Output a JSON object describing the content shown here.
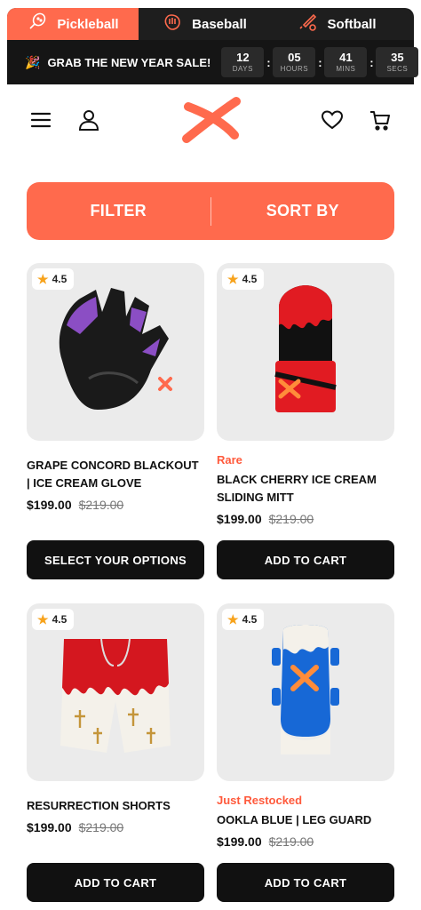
{
  "sport_tabs": [
    {
      "label": "Pickleball",
      "icon": "pickleball-paddle-icon",
      "active": true
    },
    {
      "label": "Baseball",
      "icon": "baseball-glove-icon",
      "active": false
    },
    {
      "label": "Softball",
      "icon": "softball-bat-icon",
      "active": false
    }
  ],
  "sale": {
    "text": "GRAB THE NEW YEAR SALE!",
    "icon": "party-popper-icon",
    "countdown": [
      {
        "value": "12",
        "label": "DAYS"
      },
      {
        "value": "05",
        "label": "HOURS"
      },
      {
        "value": "41",
        "label": "MINS"
      },
      {
        "value": "35",
        "label": "SECS"
      }
    ]
  },
  "header": {
    "icons": [
      "menu-icon",
      "user-icon",
      "heart-icon",
      "cart-icon"
    ],
    "logo": "brand-x-logo",
    "brand_color": "#ff6a4d"
  },
  "filter_bar": {
    "filter_label": "FILTER",
    "sort_label": "SORT BY"
  },
  "products": [
    {
      "rating": "4.5",
      "badge": "",
      "title": "GRAPE CONCORD BLACKOUT | ICE CREAM GLOVE",
      "price": "$199.00",
      "old_price": "$219.00",
      "cta": "SELECT YOUR OPTIONS"
    },
    {
      "rating": "4.5",
      "badge": "Rare",
      "title": "BLACK CHERRY ICE CREAM SLIDING MITT",
      "price": "$199.00",
      "old_price": "$219.00",
      "cta": "ADD TO CART"
    },
    {
      "rating": "4.5",
      "badge": "",
      "title": "RESURRECTION SHORTS",
      "price": "$199.00",
      "old_price": "$219.00",
      "cta": "ADD TO CART"
    },
    {
      "rating": "4.5",
      "badge": "Just Restocked",
      "title": "OOKLA BLUE | LEG GUARD",
      "price": "$199.00",
      "old_price": "$219.00",
      "cta": "ADD TO CART"
    }
  ]
}
